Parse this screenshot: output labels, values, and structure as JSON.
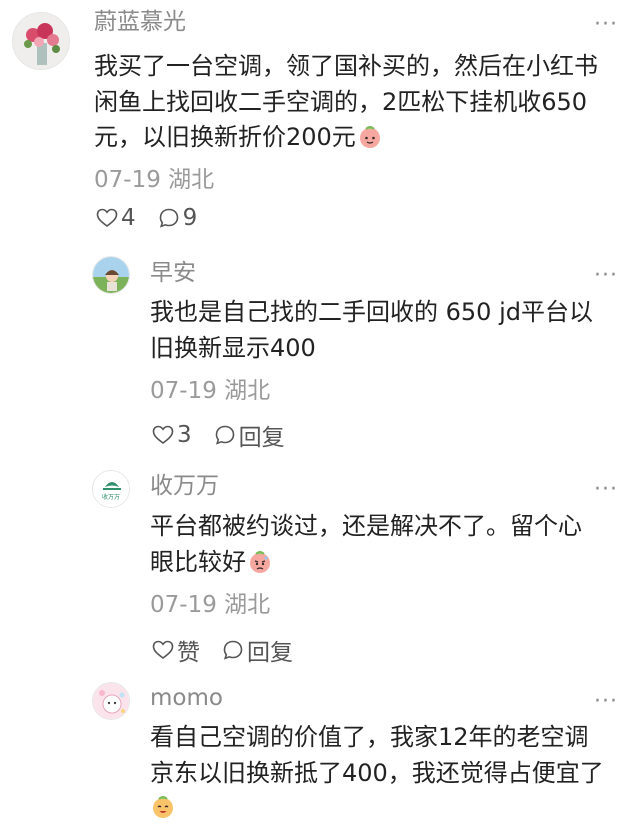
{
  "comments": [
    {
      "username": "蔚蓝慕光",
      "lines": [
        "我买了一台空调，领了国补买的，然后在小红书",
        "闲鱼上找回收二手空调的，2匹松下挂机收650",
        "元，以旧换新折价200元"
      ],
      "emoji": "peach-face-emoji",
      "date_location": "07-19 湖北",
      "likes": "4",
      "replies": "9"
    },
    {
      "username": "早安",
      "lines": [
        "我也是自己找的二手回收的 650 jd平台以",
        "旧换新显示400"
      ],
      "date_location": "07-19 湖北",
      "likes": "3",
      "reply_label": "回复"
    },
    {
      "username": "收万万",
      "avatar_text": "收万万",
      "lines": [
        "平台都被约谈过，还是解决不了。留个心",
        "眼比较好"
      ],
      "emoji": "worried-peach-emoji",
      "date_location": "07-19 湖北",
      "like_label": "赞",
      "reply_label": "回复"
    },
    {
      "username": "momo",
      "lines": [
        "看自己空调的价值了，我家12年的老空调",
        "京东以旧换新抵了400，我还觉得占便宜了"
      ],
      "emoji": "happy-peach-emoji"
    }
  ],
  "more_label": "···",
  "colors": {
    "text": "#222222",
    "muted": "#8a8a8a",
    "meta": "#9a9a9a"
  },
  "icons": {
    "like": "heart-outline-icon",
    "reply": "speech-bubble-icon"
  }
}
